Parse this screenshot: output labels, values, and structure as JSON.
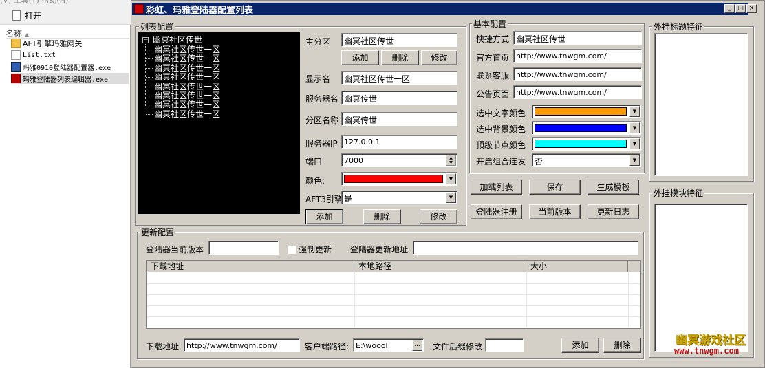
{
  "explorer": {
    "menu_fragment": "(V)   工具(T)   帮助(H)",
    "open_label": "打开",
    "column_name": "名称",
    "files": [
      {
        "name": "AFT引擎玛雅网关",
        "type": "folder"
      },
      {
        "name": "List.txt",
        "type": "txt"
      },
      {
        "name": "玛雅0910登陆器配置器.exe",
        "type": "exe1"
      },
      {
        "name": "玛雅登陆器列表编辑器.exe",
        "type": "exe2"
      }
    ]
  },
  "window": {
    "title": "彩虹、玛雅登陆器配置列表",
    "min": "_",
    "max": "□",
    "close": "×"
  },
  "list_config": {
    "group_label": "列表配置",
    "tree": {
      "root": "幽冥社区传世",
      "children": [
        "幽冥社区传世一区",
        "幽冥社区传世一区",
        "幽冥社区传世一区",
        "幽冥社区传世一区",
        "幽冥社区传世一区",
        "幽冥社区传世一区",
        "幽冥社区传世一区",
        "幽冥社区传世一区"
      ]
    },
    "main_zone_label": "主分区",
    "main_zone_value": "幽冥社区传世",
    "add_label": "添加",
    "delete_label": "删除",
    "modify_label": "修改",
    "display_name_label": "显示名",
    "display_name_value": "幽冥社区传世一区",
    "server_name_label": "服务器名",
    "server_name_value": "幽冥传世",
    "zone_name_label": "分区名称",
    "zone_name_value": "幽冥传世",
    "server_ip_label": "服务器IP",
    "server_ip_value": "127.0.0.1",
    "port_label": "端口",
    "port_value": "7000",
    "color_label": "颜色:",
    "color_value": "#ff0000",
    "aft3_label": "AFT3引擎",
    "aft3_value": "是",
    "bottom_add": "添加",
    "bottom_delete": "删除",
    "bottom_modify": "修改"
  },
  "basic_config": {
    "group_label": "基本配置",
    "shortcut_label": "快捷方式",
    "shortcut_value": "幽冥社区传世",
    "homepage_label": "官方首页",
    "homepage_value": "http://www.tnwgm.com/",
    "support_label": "联系客服",
    "support_value": "http://www.tnwgm.com/",
    "notice_label": "公告页面",
    "notice_value": "http://www.tnwgm.com/",
    "sel_text_color_label": "选中文字颜色",
    "sel_text_color": "#ff9900",
    "sel_bg_color_label": "选中背景颜色",
    "sel_bg_color": "#0000ff",
    "top_node_color_label": "顶级节点颜色",
    "top_node_color": "#00ffff",
    "combo_label": "开启组合连发",
    "combo_value": "否"
  },
  "actions": {
    "load_list": "加载列表",
    "save": "保存",
    "gen_template": "生成模板",
    "register": "登陆器注册",
    "current_version": "当前版本",
    "changelog": "更新日志"
  },
  "plugin": {
    "title_feature_label": "外挂标题特征",
    "module_feature_label": "外挂模块特征"
  },
  "update_config": {
    "group_label": "更新配置",
    "current_version_label": "登陆器当前版本",
    "current_version_value": "",
    "force_update_label": "强制更新",
    "update_url_label": "登陆器更新地址",
    "update_url_value": "",
    "columns": [
      "下载地址",
      "本地路径",
      "大小"
    ],
    "download_url_label": "下载地址",
    "download_url_value": "http://www.tnwgm.com/",
    "client_path_label": "客户端路径:",
    "client_path_value": "E:\\woool",
    "browse": "...",
    "suffix_label": "文件后缀修改",
    "suffix_value": "",
    "add": "添加",
    "delete": "删除"
  },
  "watermark": {
    "line1": "幽冥游戏社区",
    "line2": "www.tnwgm.com"
  }
}
